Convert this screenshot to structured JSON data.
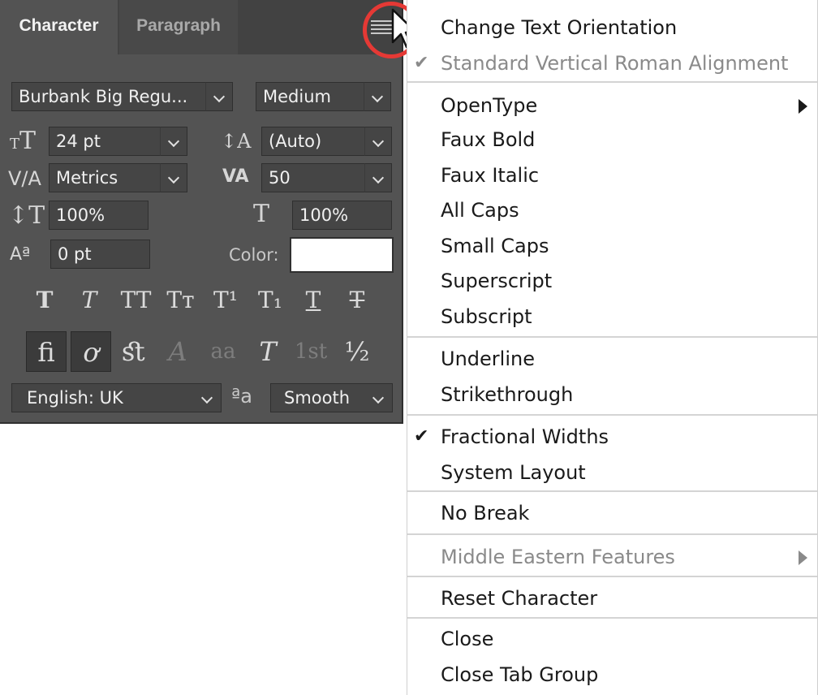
{
  "panel": {
    "tabs": [
      "Character",
      "Paragraph"
    ],
    "font_family": "Burbank Big Regu...",
    "font_style": "Medium",
    "font_size": "24 pt",
    "leading": "(Auto)",
    "kerning": "Metrics",
    "tracking": "50",
    "vertical_scale": "100%",
    "horizontal_scale": "100%",
    "baseline_shift": "0 pt",
    "color_label": "Color:",
    "color_value": "#ffffff",
    "language": "English: UK",
    "antialias": "Smooth",
    "antialias_icon": "ªa",
    "type_styles": [
      "T",
      "T",
      "TT",
      "Tт",
      "T¹",
      "T₁",
      "T",
      "T"
    ],
    "opentype": [
      "ﬁ",
      "ơ",
      "ﬆ",
      "A",
      "aa",
      "T",
      "1st",
      "½"
    ]
  },
  "menu": {
    "items": [
      {
        "label": "Change Text Orientation",
        "disabled": false,
        "checked": false,
        "submenu": false
      },
      {
        "label": "Standard Vertical Roman Alignment",
        "disabled": true,
        "checked": true,
        "submenu": false
      },
      {
        "label": "OpenType",
        "disabled": false,
        "checked": false,
        "submenu": true
      },
      {
        "label": "Faux Bold",
        "disabled": false,
        "checked": false,
        "submenu": false
      },
      {
        "label": "Faux Italic",
        "disabled": false,
        "checked": false,
        "submenu": false
      },
      {
        "label": "All Caps",
        "disabled": false,
        "checked": false,
        "submenu": false
      },
      {
        "label": "Small Caps",
        "disabled": false,
        "checked": false,
        "submenu": false
      },
      {
        "label": "Superscript",
        "disabled": false,
        "checked": false,
        "submenu": false
      },
      {
        "label": "Subscript",
        "disabled": false,
        "checked": false,
        "submenu": false
      },
      {
        "label": "Underline",
        "disabled": false,
        "checked": false,
        "submenu": false
      },
      {
        "label": "Strikethrough",
        "disabled": false,
        "checked": false,
        "submenu": false
      },
      {
        "label": "Fractional Widths",
        "disabled": false,
        "checked": true,
        "submenu": false
      },
      {
        "label": "System Layout",
        "disabled": false,
        "checked": false,
        "submenu": false
      },
      {
        "label": "No Break",
        "disabled": false,
        "checked": false,
        "submenu": false
      },
      {
        "label": "Middle Eastern Features",
        "disabled": true,
        "checked": false,
        "submenu": true
      },
      {
        "label": "Reset Character",
        "disabled": false,
        "checked": false,
        "submenu": false
      },
      {
        "label": "Close",
        "disabled": false,
        "checked": false,
        "submenu": false
      },
      {
        "label": "Close Tab Group",
        "disabled": false,
        "checked": false,
        "submenu": false
      }
    ],
    "check_glyph": "✔"
  }
}
